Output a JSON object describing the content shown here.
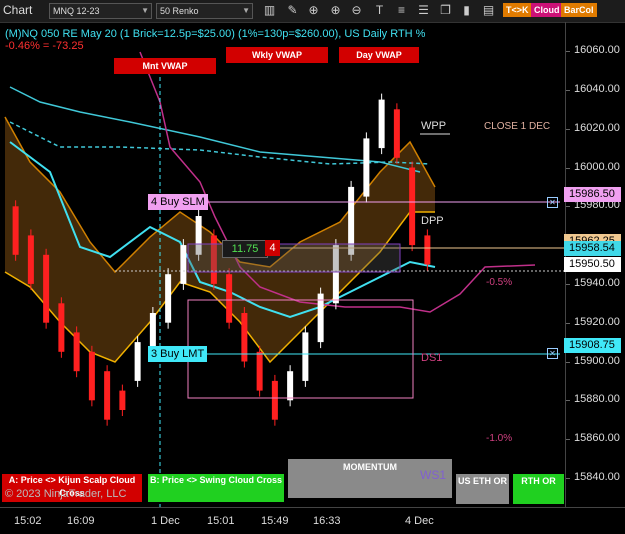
{
  "toolbar": {
    "title": "Chart",
    "instrument": "MNQ 12-23",
    "bar_type": "50 Renko",
    "icons": [
      "bar-style-icon",
      "draw-pen-icon",
      "crosshair-icon",
      "zoom-in-icon",
      "zoom-out-icon",
      "text-icon",
      "stack-icon",
      "lines-icon",
      "copy-icon",
      "bars-icon",
      "list-icon",
      "indicator-icon"
    ],
    "buttons": [
      "T<>K",
      "Cloud",
      "BarCol"
    ],
    "button_colors": [
      "#e07b00",
      "#cc1177",
      "#e07b00"
    ]
  },
  "info": {
    "line1": "(M)NQ 050 RE May 20 (1 Brick=12.5p=$25.00) (1%=130p=$260.00), US Daily RTH %",
    "line2": "-0.46% = -73.25"
  },
  "vwap_labels": [
    "Mnt VWAP",
    "Wkly VWAP",
    "Day VWAP"
  ],
  "annotations": {
    "wpp": "WPP",
    "dpp": "DPP",
    "ds1": "DS1",
    "ws1": "WS1",
    "close": "CLOSE 1 DEC",
    "pct_neg_05": "-0.5%",
    "pct_neg_1": "-1.0%"
  },
  "orders": {
    "buy_slm": "4 Buy SLM",
    "buy_lmt": "3 Buy LMT",
    "position_pnl": "11.75",
    "position_qty": "4"
  },
  "y_axis": {
    "ticks": [
      "16060.00",
      "16040.00",
      "16020.00",
      "16000.00",
      "15980.00",
      "15940.00",
      "15920.00",
      "15900.00",
      "15880.00",
      "15860.00",
      "15840.00"
    ],
    "labels": [
      {
        "text": "15986.50",
        "color": "#f0a0f0"
      },
      {
        "text": "15962.25",
        "color": "#f0c890"
      },
      {
        "text": "15958.54",
        "color": "#40d8e8"
      },
      {
        "text": "15950.50",
        "color": "#ffffff"
      },
      {
        "text": "15908.75",
        "color": "#40e8f8"
      }
    ]
  },
  "x_axis": {
    "ticks": [
      "15:02",
      "16:09",
      "1 Dec",
      "15:01",
      "15:49",
      "16:33",
      "4 Dec"
    ]
  },
  "bottom_panels": {
    "a": "A: Price <> Kijun Scalp Cloud Cross",
    "b": "B: Price <> Swing Cloud Cross",
    "momentum": "MOMENTUM",
    "us_eth_or": "US ETH OR",
    "rth_or": "RTH OR",
    "copyright": "© 2023 NinjaTrader, LLC"
  },
  "chart_data": {
    "type": "line",
    "title": "",
    "ylim": [
      15825,
      16075
    ],
    "bars": [
      {
        "o": 15980,
        "c": 15955
      },
      {
        "o": 15965,
        "c": 15940
      },
      {
        "o": 15955,
        "c": 15920
      },
      {
        "o": 15930,
        "c": 15905
      },
      {
        "o": 15915,
        "c": 15895
      },
      {
        "o": 15905,
        "c": 15880
      },
      {
        "o": 15895,
        "c": 15870
      },
      {
        "o": 15885,
        "c": 15875
      },
      {
        "o": 15890,
        "c": 15910
      },
      {
        "o": 15905,
        "c": 15925
      },
      {
        "o": 15920,
        "c": 15945
      },
      {
        "o": 15940,
        "c": 15960
      },
      {
        "o": 15955,
        "c": 15975
      },
      {
        "o": 15965,
        "c": 15940
      },
      {
        "o": 15945,
        "c": 15920
      },
      {
        "o": 15925,
        "c": 15900
      },
      {
        "o": 15905,
        "c": 15885
      },
      {
        "o": 15890,
        "c": 15870
      },
      {
        "o": 15880,
        "c": 15895
      },
      {
        "o": 15890,
        "c": 15915
      },
      {
        "o": 15910,
        "c": 15935
      },
      {
        "o": 15930,
        "c": 15960
      },
      {
        "o": 15955,
        "c": 15990
      },
      {
        "o": 15985,
        "c": 16015
      },
      {
        "o": 16010,
        "c": 16035
      },
      {
        "o": 16030,
        "c": 16005
      },
      {
        "o": 16000,
        "c": 15960
      },
      {
        "o": 15965,
        "c": 15950
      }
    ]
  }
}
